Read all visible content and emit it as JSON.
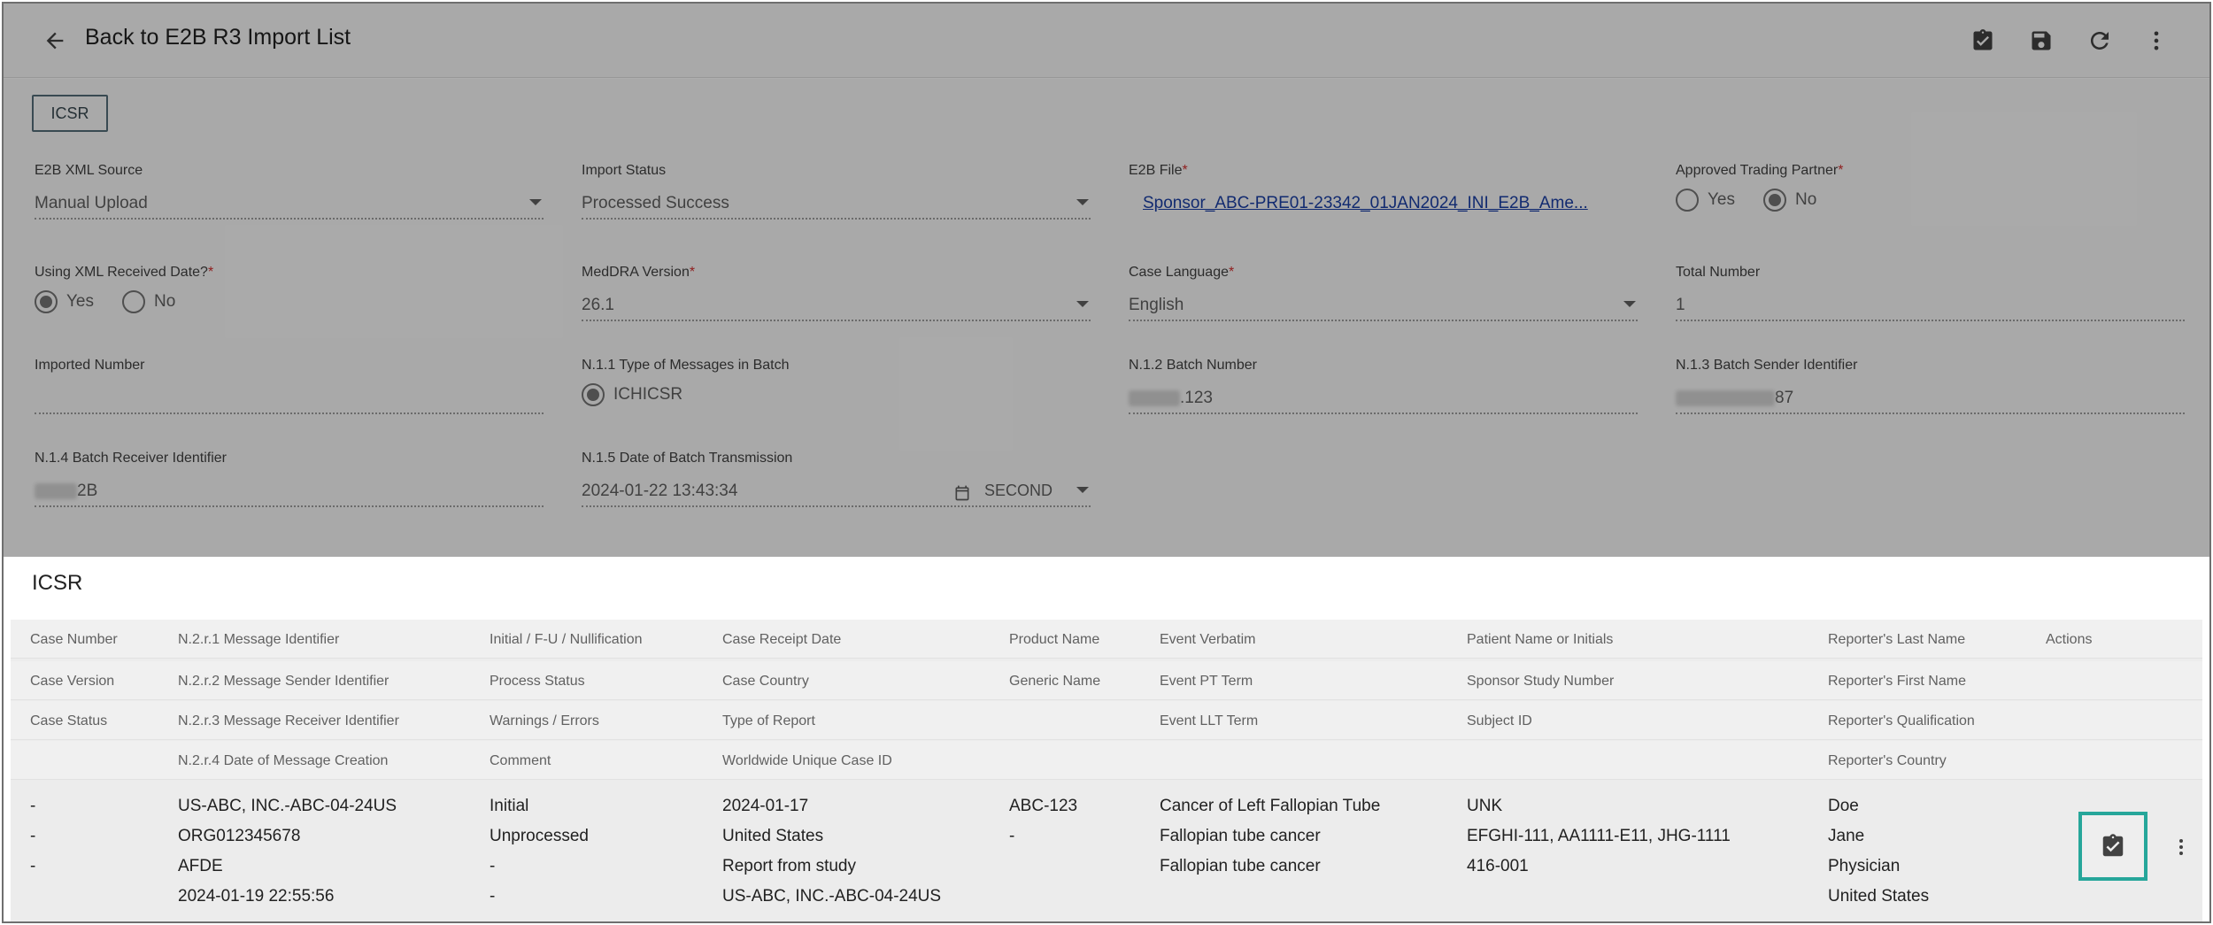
{
  "topbar": {
    "back_label": "Back to E2B R3 Import List",
    "icons": [
      "arrow-back-icon",
      "approve-clipboard-icon",
      "save-icon",
      "refresh-icon",
      "more-vert-icon"
    ]
  },
  "form": {
    "tab": "ICSR",
    "xml_source": {
      "label": "E2B XML Source",
      "value": "Manual Upload"
    },
    "import_status": {
      "label": "Import Status",
      "value": "Processed Success"
    },
    "e2b_file": {
      "label": "E2B File",
      "required": "*",
      "value": "Sponsor_ABC-PRE01-23342_01JAN2024_INI_E2B_Ame..."
    },
    "approved_partner": {
      "label": "Approved Trading Partner",
      "required": "*",
      "yes": "Yes",
      "no": "No",
      "selected": "No"
    },
    "using_xml_date": {
      "label": "Using XML Received Date?",
      "required": "*",
      "yes": "Yes",
      "no": "No",
      "selected": "Yes"
    },
    "meddra": {
      "label": "MedDRA Version",
      "required": "*",
      "value": "26.1"
    },
    "case_language": {
      "label": "Case Language",
      "required": "*",
      "value": "English"
    },
    "total_number": {
      "label": "Total Number",
      "value": "1"
    },
    "imported_number": {
      "label": "Imported Number",
      "value": ""
    },
    "n11": {
      "label": "N.1.1 Type of Messages in Batch",
      "option": "ICHICSR"
    },
    "n12": {
      "label": "N.1.2 Batch Number",
      "value": ".123"
    },
    "n13": {
      "label": "N.1.3 Batch Sender Identifier",
      "value": "87"
    },
    "n14": {
      "label": "N.1.4 Batch Receiver Identifier",
      "value": "2B"
    },
    "n15": {
      "label": "N.1.5 Date of Batch Transmission",
      "value": "2024-01-22 13:43:34",
      "precision": "SECOND"
    }
  },
  "icsr": {
    "title": "ICSR",
    "headers": {
      "row1": [
        "Case Number",
        "N.2.r.1 Message Identifier",
        "Initial / F-U / Nullification",
        "Case Receipt Date",
        "Product Name",
        "Event Verbatim",
        "Patient Name or Initials",
        "Reporter's Last Name",
        "Actions"
      ],
      "row2": [
        "Case Version",
        "N.2.r.2 Message Sender Identifier",
        "Process Status",
        "Case Country",
        "Generic Name",
        "Event PT Term",
        "Sponsor Study Number",
        "Reporter's First Name"
      ],
      "row3": [
        "Case Status",
        "N.2.r.3 Message Receiver Identifier",
        "Warnings / Errors",
        "Type of Report",
        "",
        "Event LLT Term",
        "Subject ID",
        "Reporter's Qualification"
      ],
      "row4": [
        "",
        "N.2.r.4 Date of Message Creation",
        "Comment",
        "Worldwide Unique Case ID",
        "",
        "",
        "",
        "Reporter's Country"
      ]
    },
    "row": {
      "col1": [
        "-",
        "-",
        "-",
        ""
      ],
      "col2": [
        "US-ABC, INC.-ABC-04-24US",
        "ORG012345678",
        "AFDE",
        "2024-01-19 22:55:56"
      ],
      "col3": [
        "Initial",
        "Unprocessed",
        "-",
        "-"
      ],
      "col4": [
        "2024-01-17",
        "United States",
        "Report from study",
        "US-ABC, INC.-ABC-04-24US"
      ],
      "col5": [
        "ABC-123",
        "-",
        "",
        ""
      ],
      "col6": [
        "Cancer of Left Fallopian Tube",
        "Fallopian tube cancer",
        "Fallopian tube cancer",
        ""
      ],
      "col7": [
        "UNK",
        "EFGHI-111, AA1111-E11, JHG-1111",
        "416-001",
        ""
      ],
      "col8": [
        "Doe",
        "Jane",
        "Physician",
        "United States"
      ]
    },
    "highlight_color": "#26a69a"
  }
}
